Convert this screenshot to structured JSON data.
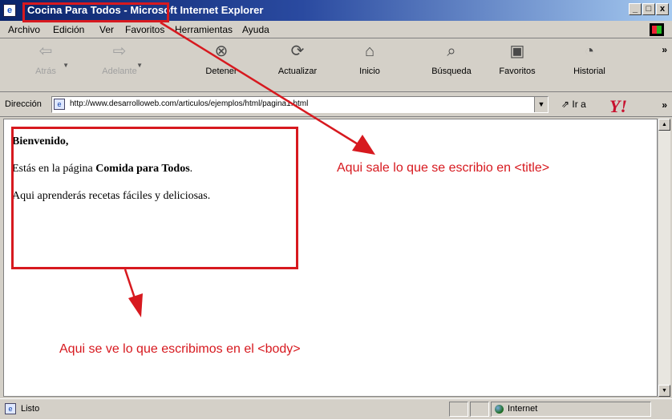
{
  "window": {
    "title": "Cocina Para Todos - Microsoft Internet Explorer",
    "controls": [
      "_",
      "□",
      "x"
    ]
  },
  "menu": [
    "Archivo",
    "Edición",
    "Ver",
    "Favoritos",
    "Herramientas",
    "Ayuda"
  ],
  "toolbar": [
    {
      "label": "Atrás",
      "icon": "back-arrow-icon",
      "glyph": "⇦",
      "enabled": false
    },
    {
      "label": "Adelante",
      "icon": "forward-arrow-icon",
      "glyph": "⇨",
      "enabled": false
    },
    {
      "label": "Detener",
      "icon": "stop-icon",
      "glyph": "⊗",
      "enabled": true
    },
    {
      "label": "Actualizar",
      "icon": "refresh-icon",
      "glyph": "⟳",
      "enabled": true
    },
    {
      "label": "Inicio",
      "icon": "home-icon",
      "glyph": "⌂",
      "enabled": true
    },
    {
      "label": "Búsqueda",
      "icon": "search-icon",
      "glyph": "⌕",
      "enabled": true
    },
    {
      "label": "Favoritos",
      "icon": "favorites-icon",
      "glyph": "▣",
      "enabled": true
    },
    {
      "label": "Historial",
      "icon": "history-icon",
      "glyph": "◔",
      "enabled": true
    }
  ],
  "address": {
    "label": "Dirección",
    "url": "http://www.desarrolloweb.com/articulos/ejemplos/html/pagina1.html",
    "go_label": "Ir a",
    "toolbar_logo": "Y!"
  },
  "page": {
    "greeting": "Bienvenido,",
    "line2_prefix": "Estás en la página ",
    "line2_bold": "Comida para Todos",
    "line2_suffix": ".",
    "line3": "Aqui aprenderás recetas fáciles y deliciosas."
  },
  "status": {
    "text": "Listo",
    "zone": "Internet"
  },
  "annotations": {
    "title_note": "Aqui sale lo que se escribio en <title>",
    "body_note": "Aqui se ve lo que escribimos en el <body>",
    "color": "#d7191f"
  }
}
